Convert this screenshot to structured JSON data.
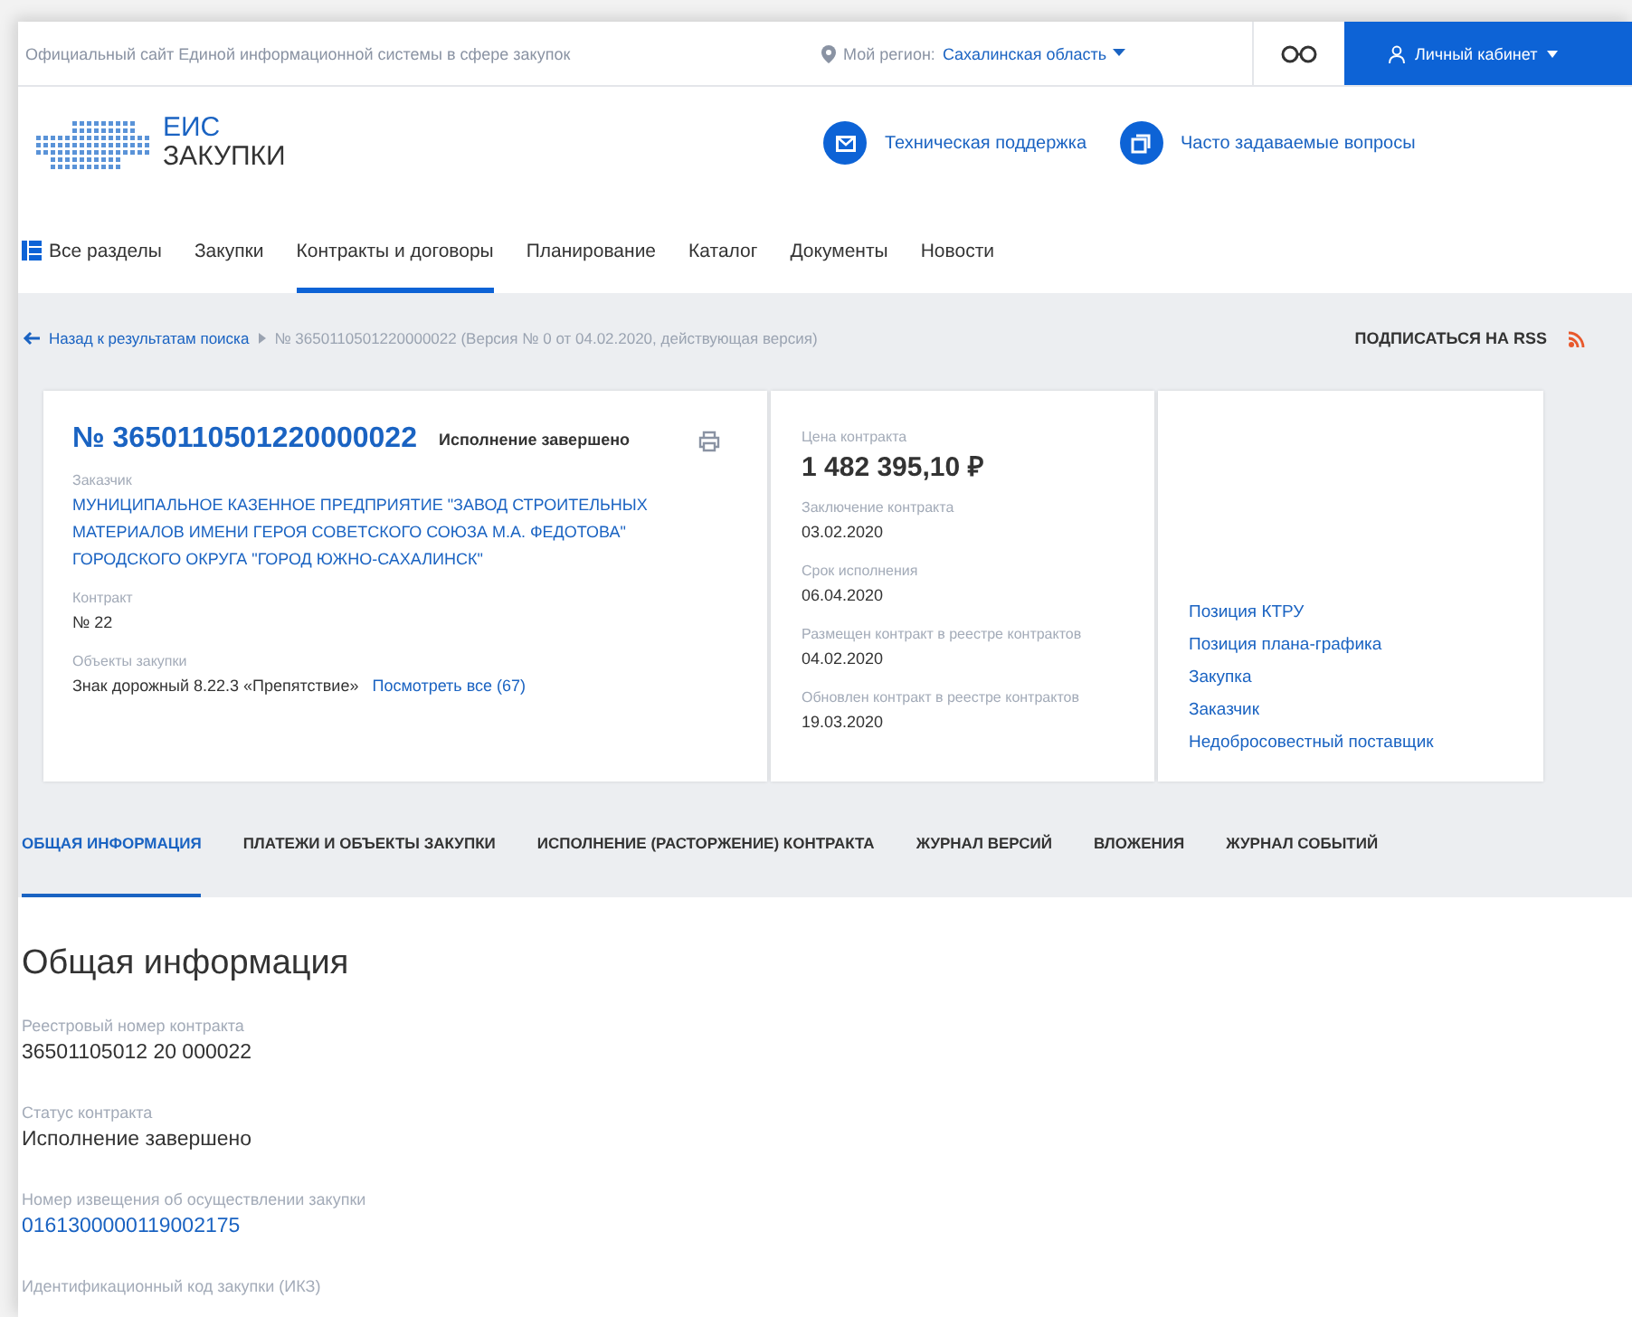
{
  "top_bar": {
    "site_title": "Официальный сайт Единой информационной системы в сфере закупок",
    "region_label": "Мой регион:",
    "region_value": "Сахалинская область",
    "account": "Личный кабинет"
  },
  "header": {
    "logo_line1": "ЕИС",
    "logo_line2": "ЗАКУПКИ",
    "links": [
      "Техническая поддержка",
      "Часто задаваемые вопросы"
    ]
  },
  "nav": {
    "all_sections": "Все разделы",
    "items": [
      {
        "label": "Закупки",
        "selected": false
      },
      {
        "label": "Контракты и договоры",
        "selected": true
      },
      {
        "label": "Планирование",
        "selected": false
      },
      {
        "label": "Каталог",
        "selected": false
      },
      {
        "label": "Документы",
        "selected": false
      },
      {
        "label": "Новости",
        "selected": false
      }
    ]
  },
  "breadcrumb": {
    "back": "Назад к результатам поиска",
    "current": "№ 3650110501220000022 (Версия № 0 от 04.02.2020, действующая версия)",
    "rss": "ПОДПИСАТЬСЯ НА RSS"
  },
  "contract_card": {
    "number": "№ 3650110501220000022",
    "status": "Исполнение завершено",
    "customer_label": "Заказчик",
    "customer": "МУНИЦИПАЛЬНОЕ КАЗЕННОЕ ПРЕДПРИЯТИЕ \"ЗАВОД СТРОИТЕЛЬНЫХ МАТЕРИАЛОВ ИМЕНИ ГЕРОЯ СОВЕТСКОГО СОЮЗА М.А. ФЕДОТОВА\" ГОРОДСКОГО ОКРУГА \"ГОРОД ЮЖНО-САХАЛИНСК\"",
    "contract_label": "Контракт",
    "contract": "№ 22",
    "objects_label": "Объекты закупки",
    "objects": "Знак дорожный 8.22.3 «Препятствие»",
    "objects_link": "Посмотреть все (67)"
  },
  "price_card": {
    "price_label": "Цена контракта",
    "price": "1 482 395,10 ₽",
    "dates": [
      {
        "label": "Заключение контракта",
        "value": "03.02.2020"
      },
      {
        "label": "Срок исполнения",
        "value": "06.04.2020"
      },
      {
        "label": "Размещен контракт в реестре контрактов",
        "value": "04.02.2020"
      },
      {
        "label": "Обновлен контракт в реестре контрактов",
        "value": "19.03.2020"
      }
    ]
  },
  "related_links": [
    "Позиция КТРУ",
    "Позиция плана-графика",
    "Закупка",
    "Заказчик",
    "Недобросовестный поставщик"
  ],
  "tabs": [
    {
      "label": "ОБЩАЯ ИНФОРМАЦИЯ",
      "selected": true
    },
    {
      "label": "ПЛАТЕЖИ И ОБЪЕКТЫ ЗАКУПКИ",
      "selected": false
    },
    {
      "label": "ИСПОЛНЕНИЕ (РАСТОРЖЕНИЕ) КОНТРАКТА",
      "selected": false
    },
    {
      "label": "ЖУРНАЛ ВЕРСИЙ",
      "selected": false
    },
    {
      "label": "ВЛОЖЕНИЯ",
      "selected": false
    },
    {
      "label": "ЖУРНАЛ СОБЫТИЙ",
      "selected": false
    }
  ],
  "section": {
    "title": "Общая информация",
    "fields": [
      {
        "label": "Реестровый номер контракта",
        "value": "36501105012 20 000022",
        "kind": "text"
      },
      {
        "label": "Статус контракта",
        "value": "Исполнение завершено",
        "kind": "text"
      },
      {
        "label": "Номер извещения об осуществлении закупки",
        "value": "0161300000119002175",
        "kind": "link"
      },
      {
        "label": "Идентификационный код закупки (ИКЗ)",
        "kind": "label_only"
      }
    ]
  }
}
